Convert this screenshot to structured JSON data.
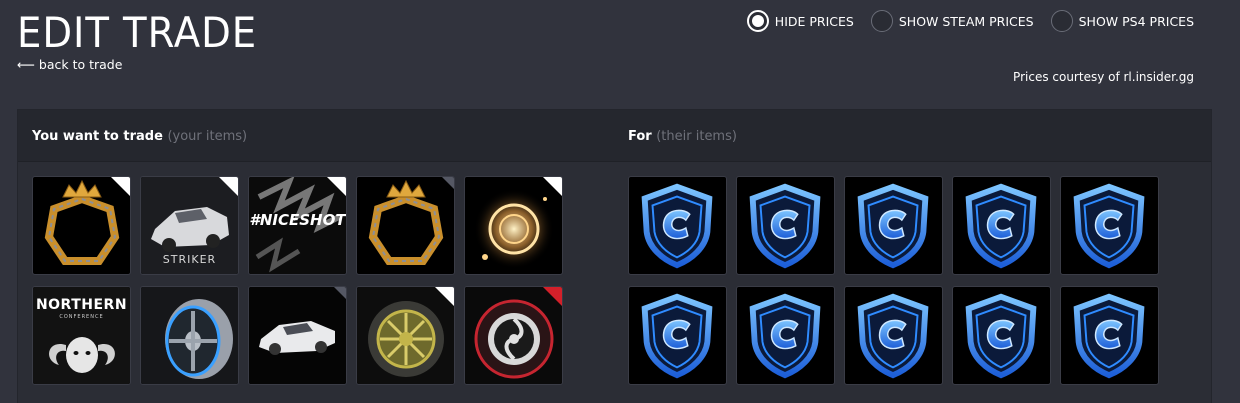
{
  "header": {
    "title": "EDIT TRADE",
    "back_link": "⟵ back to trade"
  },
  "price_options": {
    "selected": "hide",
    "options": [
      {
        "id": "hide",
        "label": "HIDE PRICES"
      },
      {
        "id": "steam",
        "label": "SHOW STEAM PRICES"
      },
      {
        "id": "ps4",
        "label": "SHOW PS4 PRICES"
      }
    ],
    "courtesy": "Prices courtesy of rl.insider.gg"
  },
  "your_items": {
    "heading": "You want to trade",
    "subheading": "(your items)",
    "items": [
      {
        "icon": "gold-crown-frame-icon",
        "caption": ""
      },
      {
        "icon": "car-striker-icon",
        "caption": "STRIKER"
      },
      {
        "icon": "niceshot-decal-icon",
        "caption": "#NICESHOT"
      },
      {
        "icon": "gold-crown-frame-icon",
        "caption": ""
      },
      {
        "icon": "gold-orb-icon",
        "caption": ""
      },
      {
        "icon": "northern-conference-icon",
        "caption": "NORTHERN",
        "subcaption": "CONFERENCE"
      },
      {
        "icon": "wheel-icon",
        "caption": ""
      },
      {
        "icon": "car-white-icon",
        "caption": ""
      },
      {
        "icon": "gold-wheel-icon",
        "caption": ""
      },
      {
        "icon": "red-wheel-icon",
        "caption": ""
      }
    ]
  },
  "their_items": {
    "heading": "For",
    "subheading": "(their items)",
    "items": [
      {
        "icon": "credits-icon"
      },
      {
        "icon": "credits-icon"
      },
      {
        "icon": "credits-icon"
      },
      {
        "icon": "credits-icon"
      },
      {
        "icon": "credits-icon"
      },
      {
        "icon": "credits-icon"
      },
      {
        "icon": "credits-icon"
      },
      {
        "icon": "credits-icon"
      },
      {
        "icon": "credits-icon"
      },
      {
        "icon": "credits-icon"
      }
    ]
  },
  "colors": {
    "background": "#31333d",
    "panel": "#2b2d35",
    "accent_blue": "#2f8bff",
    "gold": "#d9a441",
    "rarity_red": "#d3202a"
  }
}
